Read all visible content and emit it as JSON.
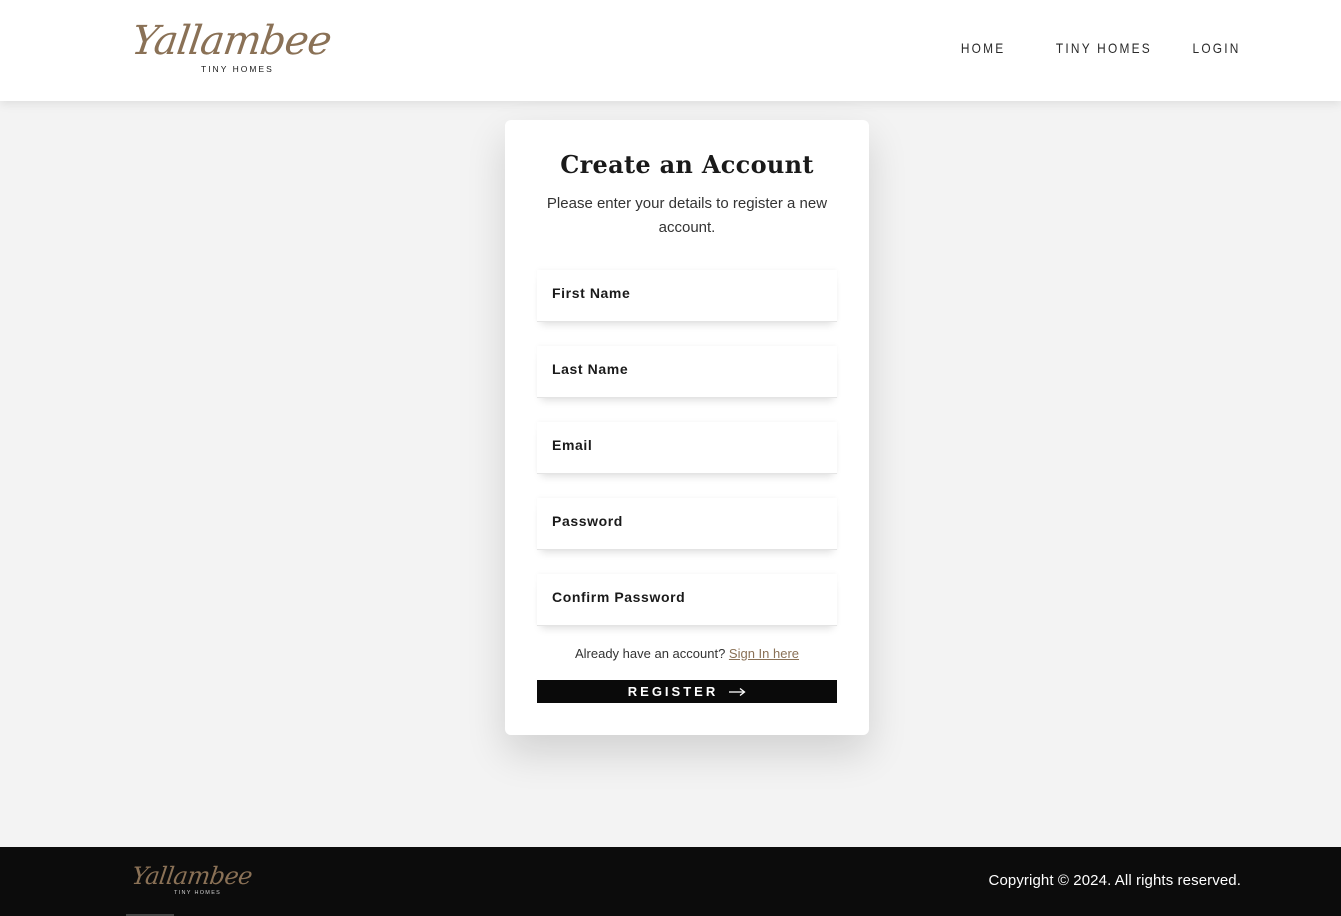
{
  "header": {
    "logo_text": "Yallambee",
    "logo_subtext": "TINY HOMES",
    "nav": [
      "HOME",
      "TINY HOMES",
      "LOGIN"
    ]
  },
  "card": {
    "title": "Create an Account",
    "subtitle": "Please enter your details to register a new account.",
    "fields": [
      {
        "label": "First Name",
        "value": ""
      },
      {
        "label": "Last Name",
        "value": ""
      },
      {
        "label": "Email",
        "value": ""
      },
      {
        "label": "Password",
        "value": ""
      },
      {
        "label": "Confirm Password",
        "value": ""
      }
    ],
    "signin_prompt": "Already have an account?",
    "signin_link": "Sign In here",
    "register_label": "REGISTER"
  },
  "footer": {
    "logo_text": "Yallambee",
    "logo_subtext": "TINY HOMES",
    "copyright": "Copyright © 2024. All rights reserved."
  },
  "colors": {
    "brand": "#8a7156",
    "button_bg": "#0a0a0a",
    "footer_bg": "#0c0c0c",
    "page_bg": "#f3f3f3"
  },
  "icons": {
    "register_arrow": "arrow-right-icon"
  }
}
